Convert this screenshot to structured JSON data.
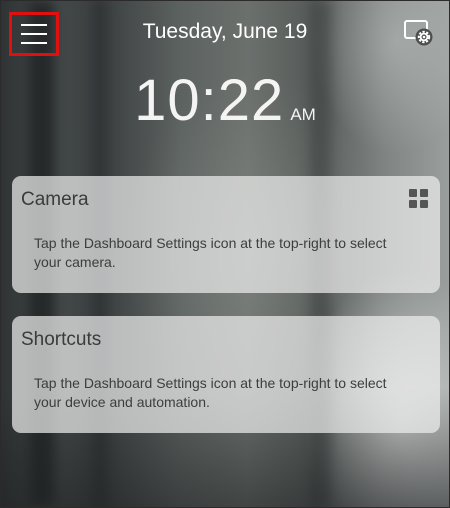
{
  "header": {
    "date": "Tuesday, June 19",
    "menu_icon": "hamburger-menu-icon",
    "settings_icon": "dashboard-settings-icon"
  },
  "clock": {
    "time": "10:22",
    "ampm": "AM"
  },
  "cards": {
    "camera": {
      "title": "Camera",
      "description": "Tap the Dashboard Settings icon at the top-right to select your camera.",
      "icon": "grid-layout-icon"
    },
    "shortcuts": {
      "title": "Shortcuts",
      "description": "Tap the Dashboard Settings icon at the top-right to select your device and automation."
    }
  },
  "colors": {
    "highlight": "#e01010",
    "text_light": "#ffffff",
    "card_bg": "#ebebeb"
  }
}
